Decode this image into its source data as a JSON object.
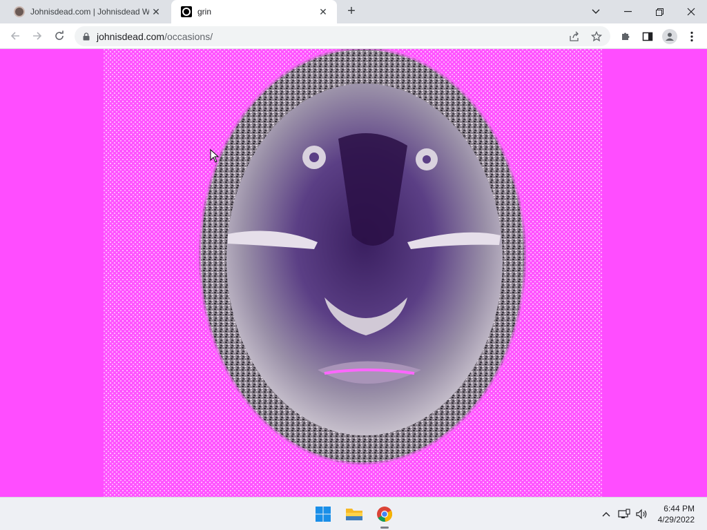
{
  "browser": {
    "tabs": [
      {
        "title": "Johnisdead.com | Johnisdead Wi",
        "state": "inactive",
        "favicon": "johnisdead-favicon"
      },
      {
        "title": "grin",
        "state": "active",
        "favicon": "grin-favicon"
      }
    ],
    "address": {
      "host": "johnisdead.com",
      "path": "/occasions/"
    }
  },
  "page": {
    "background_color": "#ff4dff",
    "image_description_icon": "distorted-face-mask-image"
  },
  "taskbar": {
    "apps": [
      "windows-start-icon",
      "file-explorer-icon",
      "chrome-icon"
    ],
    "time": "6:44 PM",
    "date": "4/29/2022"
  }
}
